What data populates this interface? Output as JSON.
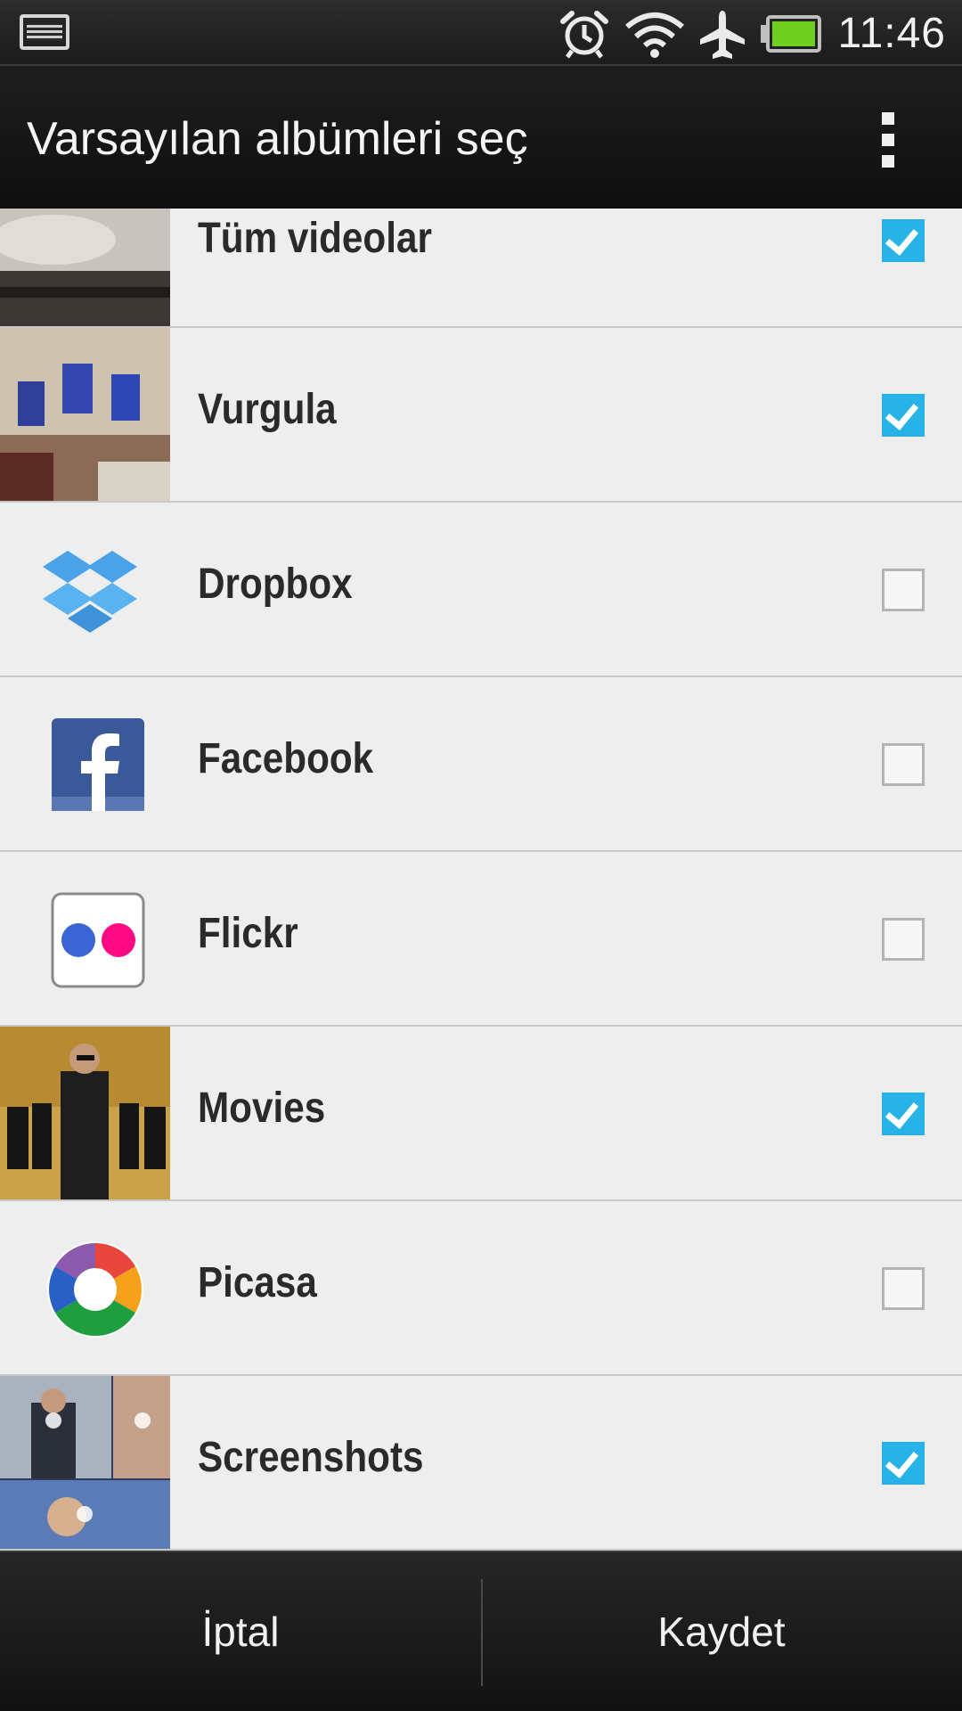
{
  "status_bar": {
    "time": "11:46",
    "icons": [
      "screenshot-icon",
      "alarm-icon",
      "wifi-icon",
      "airplane-mode-icon",
      "battery-icon"
    ]
  },
  "action_bar": {
    "title": "Varsayılan albümleri seç",
    "overflow_icon": "overflow-menu-icon"
  },
  "albums": [
    {
      "label": "Tüm videolar",
      "checked": true,
      "icon": "video-thumbnail"
    },
    {
      "label": "Vurgula",
      "checked": true,
      "icon": "highlight-thumbnail"
    },
    {
      "label": "Dropbox",
      "checked": false,
      "icon": "dropbox-icon"
    },
    {
      "label": "Facebook",
      "checked": false,
      "icon": "facebook-icon"
    },
    {
      "label": "Flickr",
      "checked": false,
      "icon": "flickr-icon"
    },
    {
      "label": "Movies",
      "checked": true,
      "icon": "movies-thumbnail"
    },
    {
      "label": "Picasa",
      "checked": false,
      "icon": "picasa-icon"
    },
    {
      "label": "Screenshots",
      "checked": true,
      "icon": "screenshots-thumbnail"
    }
  ],
  "bottom_bar": {
    "cancel_label": "İptal",
    "save_label": "Kaydet"
  },
  "colors": {
    "checkbox_checked": "#27b3e8",
    "list_background": "#eeeeee"
  }
}
